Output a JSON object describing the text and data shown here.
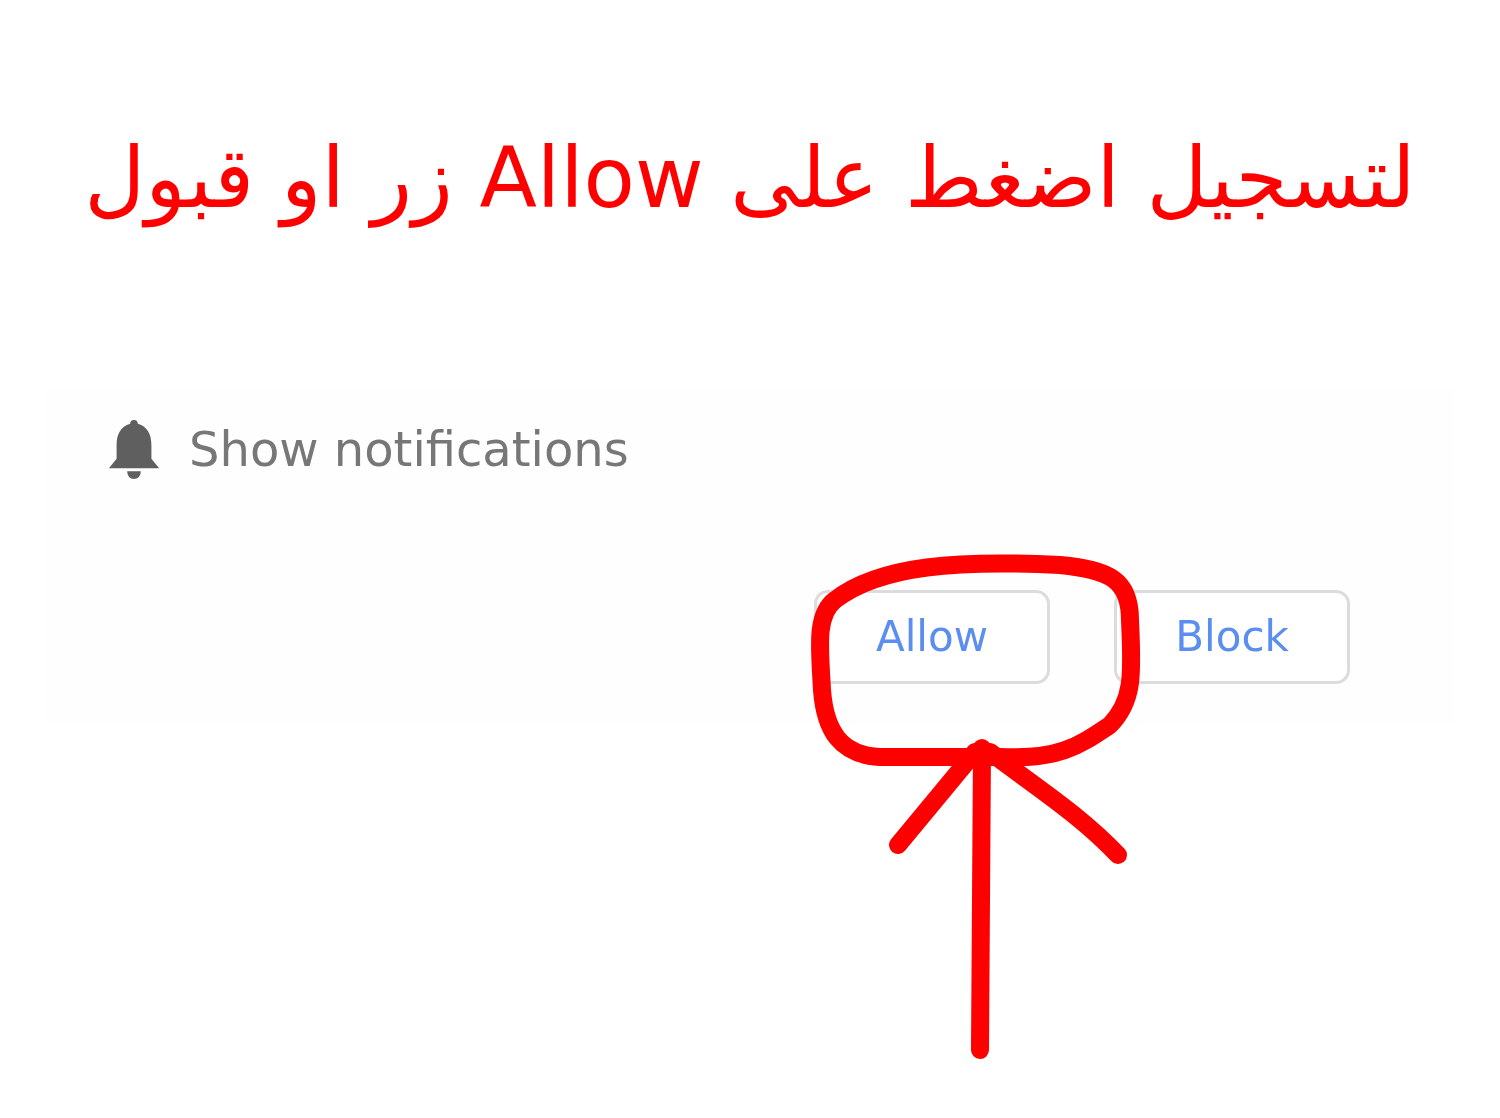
{
  "annotation": {
    "text": "لتسجيل اضغط على Allow زر او قبول"
  },
  "prompt": {
    "title": "Show notifications",
    "buttons": [
      {
        "label": "Allow"
      },
      {
        "label": "Block"
      }
    ]
  }
}
